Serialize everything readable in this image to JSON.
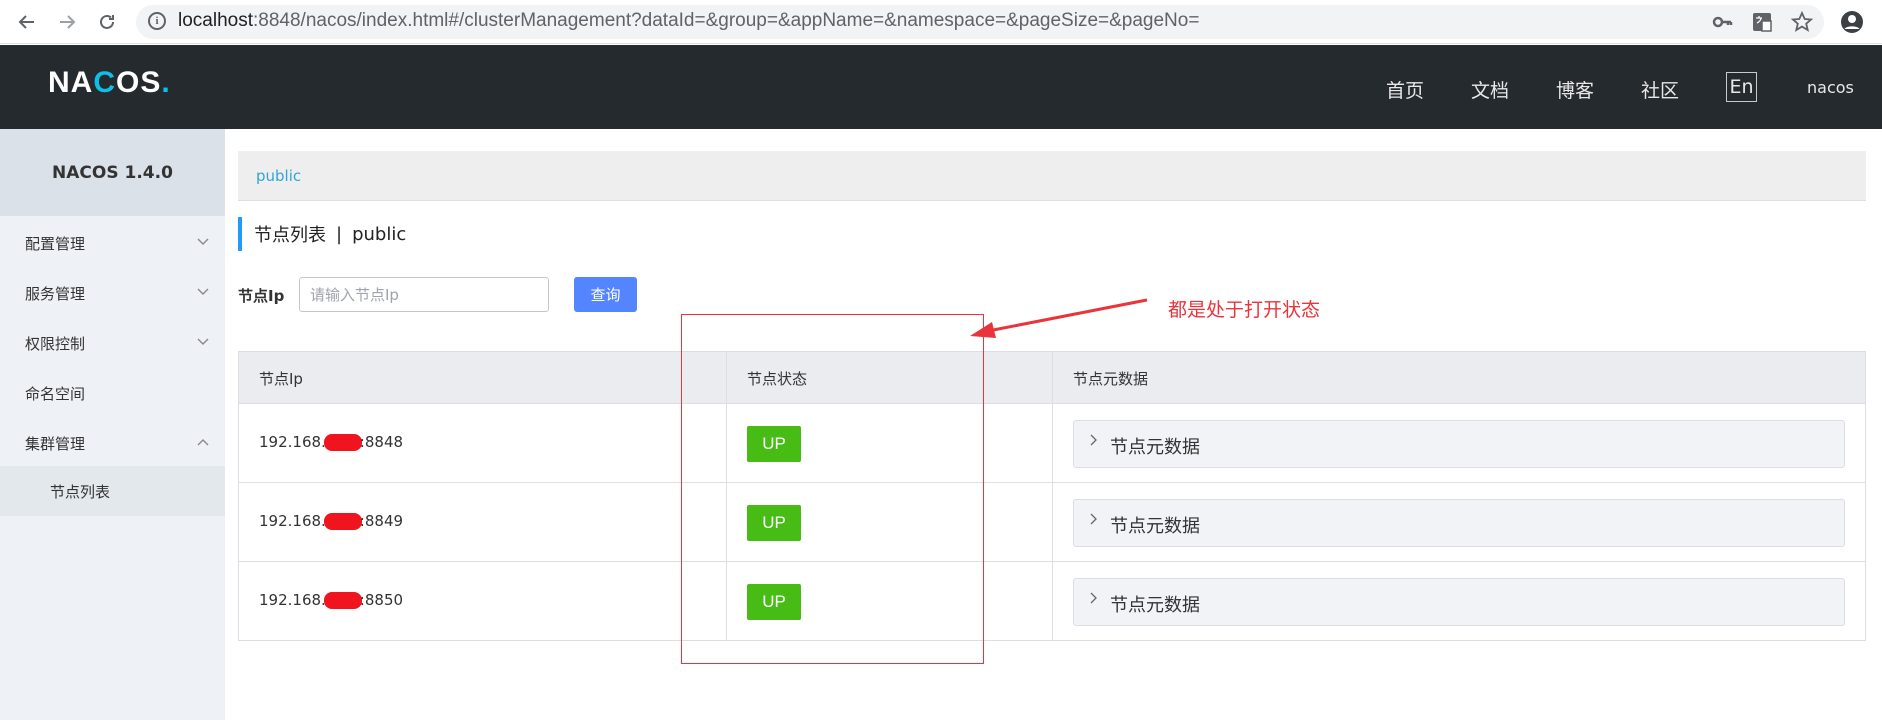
{
  "browser": {
    "url_host": "localhost",
    "url_rest": ":8848/nacos/index.html#/clusterManagement?dataId=&group=&appName=&namespace=&pageSize=&pageNo=",
    "info_glyph": "i",
    "icons": [
      "back-icon",
      "forward-icon",
      "reload-icon",
      "info-icon",
      "key-icon",
      "translate-icon",
      "star-icon",
      "account-icon"
    ]
  },
  "header": {
    "logo_a": "NA",
    "logo_c": "C",
    "logo_b": "OS",
    "logo_dot": ".",
    "nav": [
      "首页",
      "文档",
      "博客",
      "社区"
    ],
    "lang": "En",
    "user": "nacos"
  },
  "sidebar": {
    "title": "NACOS 1.4.0",
    "items": [
      {
        "label": "配置管理",
        "chevron": "down"
      },
      {
        "label": "服务管理",
        "chevron": "down"
      },
      {
        "label": "权限控制",
        "chevron": "down"
      },
      {
        "label": "命名空间",
        "chevron": "none"
      },
      {
        "label": "集群管理",
        "chevron": "up"
      }
    ],
    "subitem": "节点列表"
  },
  "breadcrumb": "public",
  "heading": {
    "title": "节点列表",
    "separator": "|",
    "namespace": "public"
  },
  "filter": {
    "label": "节点Ip",
    "placeholder": "请输入节点Ip",
    "button": "查询"
  },
  "table": {
    "headers": [
      "节点Ip",
      "节点状态",
      "节点元数据"
    ],
    "rows": [
      {
        "ip_prefix": "192.168.",
        "ip_suffix": ":8848",
        "status": "UP",
        "meta": "节点元数据"
      },
      {
        "ip_prefix": "192.168.",
        "ip_suffix": ":8849",
        "status": "UP",
        "meta": "节点元数据"
      },
      {
        "ip_prefix": "192.168.",
        "ip_suffix": ":8850",
        "status": "UP",
        "meta": "节点元数据"
      }
    ]
  },
  "annotation": {
    "text": "都是处于打开状态",
    "color": "#e8343a"
  },
  "colors": {
    "header_bg": "#252a2f",
    "accent": "#0ec0e6",
    "primary_button": "#5584ff",
    "status_up": "#46bc15"
  }
}
